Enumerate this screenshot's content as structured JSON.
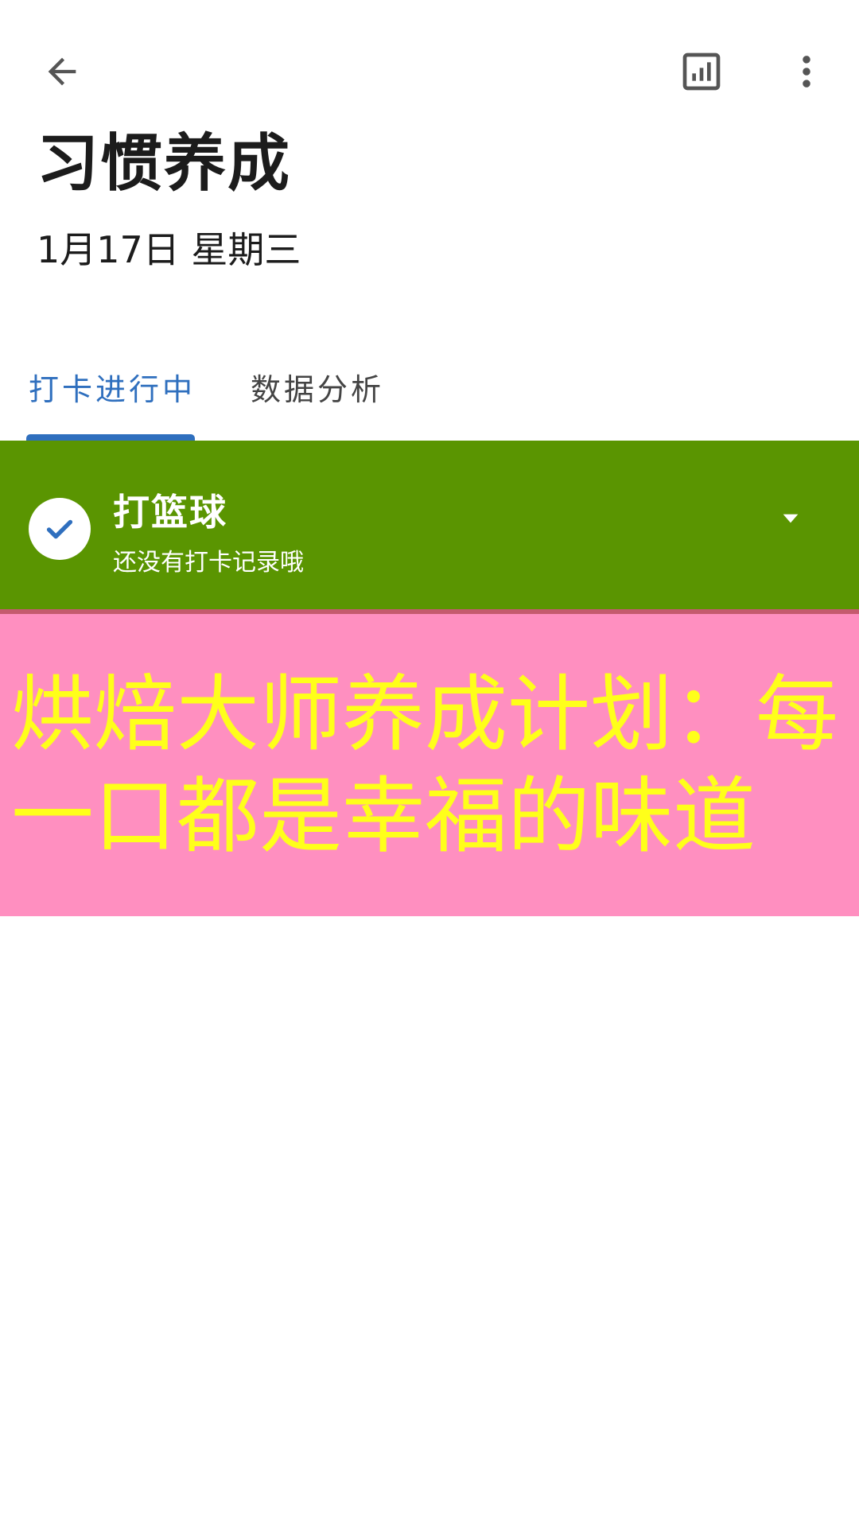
{
  "header": {
    "back_icon": "arrow-left-icon",
    "stats_icon": "bar-chart-icon",
    "more_icon": "more-vert-icon",
    "title": "习惯养成",
    "date": "1月17日 星期三"
  },
  "tabs": [
    {
      "label": "打卡进行中",
      "active": true
    },
    {
      "label": "数据分析",
      "active": false
    }
  ],
  "habit": {
    "name": "打篮球",
    "status": "还没有打卡记录哦",
    "checked": true,
    "card_color": "#5a9501"
  },
  "banner": {
    "line1": "烘焙大师养成计划：每",
    "line2": "一口都是幸福的味道",
    "background": "#ff8fc0",
    "text_color": "#ffff1a"
  },
  "colors": {
    "accent": "#2f6fbe"
  }
}
